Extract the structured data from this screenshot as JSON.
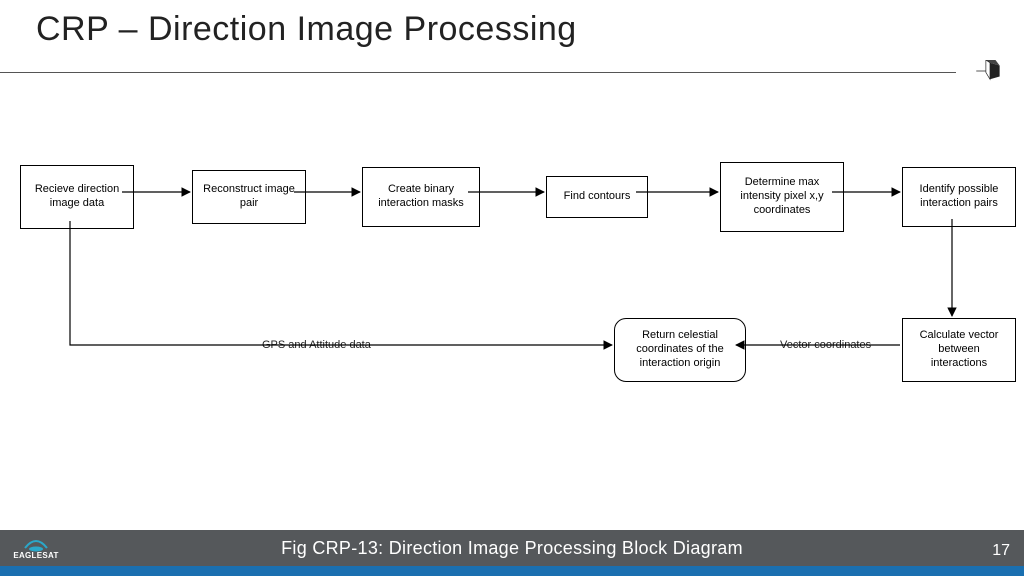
{
  "title": "CRP – Direction Image Processing",
  "caption": "Fig CRP-13: Direction Image Processing Block Diagram",
  "page_number": "17",
  "logo_text": "EAGLESAT",
  "nodes": {
    "n1": "Recieve direction image data",
    "n2": "Reconstruct image pair",
    "n3": "Create binary interaction masks",
    "n4": "Find contours",
    "n5": "Determine max intensity pixel x,y coordinates",
    "n6": "Identify possible interaction pairs",
    "n7": "Calculate vector between interactions",
    "n8": "Return celestial coordinates of the interaction origin"
  },
  "edges": {
    "e_gps": "GPS and Attitude data",
    "e_vec": "Vector coordinates"
  },
  "chart_data": {
    "type": "block_flow_diagram",
    "nodes": [
      {
        "id": "n1",
        "label": "Recieve direction image data",
        "shape": "rect"
      },
      {
        "id": "n2",
        "label": "Reconstruct image pair",
        "shape": "rect"
      },
      {
        "id": "n3",
        "label": "Create binary interaction masks",
        "shape": "rect"
      },
      {
        "id": "n4",
        "label": "Find contours",
        "shape": "rect"
      },
      {
        "id": "n5",
        "label": "Determine max intensity pixel x,y coordinates",
        "shape": "rect"
      },
      {
        "id": "n6",
        "label": "Identify possible interaction pairs",
        "shape": "rect"
      },
      {
        "id": "n7",
        "label": "Calculate vector between interactions",
        "shape": "rect"
      },
      {
        "id": "n8",
        "label": "Return celestial coordinates of the interaction origin",
        "shape": "rounded"
      }
    ],
    "edges": [
      {
        "from": "n1",
        "to": "n2"
      },
      {
        "from": "n2",
        "to": "n3"
      },
      {
        "from": "n3",
        "to": "n4"
      },
      {
        "from": "n4",
        "to": "n5"
      },
      {
        "from": "n5",
        "to": "n6"
      },
      {
        "from": "n6",
        "to": "n7"
      },
      {
        "from": "n7",
        "to": "n8",
        "label": "Vector coordinates"
      },
      {
        "from": "n1",
        "to": "n8",
        "label": "GPS and Attitude data"
      }
    ]
  }
}
